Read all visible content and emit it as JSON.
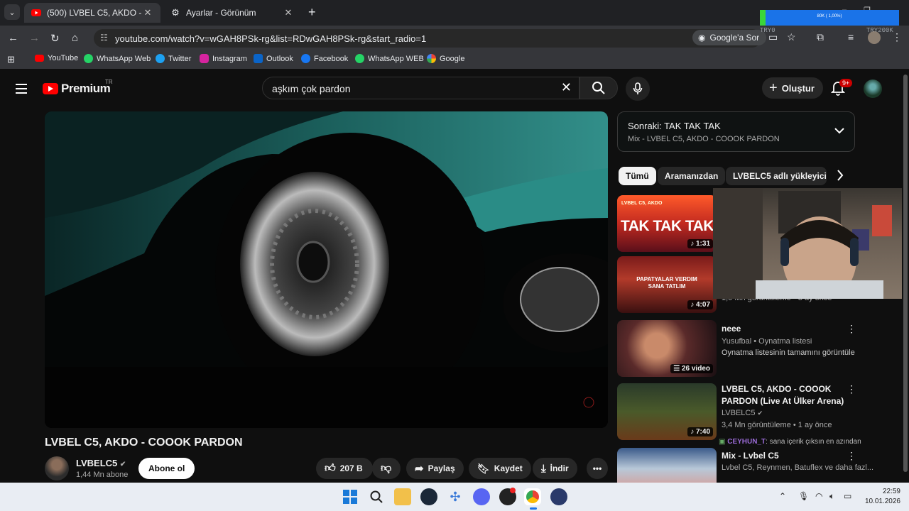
{
  "browser": {
    "tabs": [
      {
        "title": "(500) LVBEL C5, AKDO - COOO",
        "active": true
      },
      {
        "title": "Ayarlar - Görünüm",
        "active": false
      }
    ],
    "url": "youtube.com/watch?v=wGAH8PSk-rg&list=RDwGAH8PSk-rg&start_radio=1",
    "google_search_label": "Google'a Sor",
    "bookmarks": [
      "YouTube",
      "WhatsApp Web",
      "Twitter",
      "Instagram",
      "Outlook",
      "Facebook",
      "WhatsApp WEB",
      "Google"
    ]
  },
  "overlay_meter": {
    "text": "80K ( 1,00%)",
    "left_label": "TRY0",
    "right_label": "TRY200K",
    "fill_fraction": 0.04
  },
  "youtube": {
    "logo_text": "Premium",
    "region": "TR",
    "search_query": "aşkım çok pardon",
    "create_label": "Oluştur",
    "notification_count": "9+",
    "video": {
      "title": "LVBEL C5, AKDO - COOOK PARDON",
      "channel": "LVBELC5",
      "subscribers": "1,44 Mn abone",
      "subscribe_label": "Abone ol",
      "likes": "207 B",
      "share_label": "Paylaş",
      "save_label": "Kaydet",
      "download_label": "İndir"
    },
    "up_next": {
      "title": "Sonraki: TAK TAK TAK",
      "subtitle": "Mix - LVBEL C5, AKDO - COOOK PARDON"
    },
    "chips": [
      "Tümü",
      "Aramanızdan",
      "LVBELC5 adlı yükleyicide"
    ],
    "related": [
      {
        "thumb_text": "TAK TAK TAK",
        "thumb_sub": "LVBEL C5, AKDO",
        "duration": "1:31",
        "title": "",
        "meta": ""
      },
      {
        "thumb_text": "PAPATYALAR VERDIM SANA TATLIM",
        "duration": "4:07",
        "title": "",
        "meta": "1,0 Mn görüntüleme • 3 ay önce"
      },
      {
        "duration": "26 video",
        "title": "neee",
        "meta": "Yusufbal • Oynatma listesi",
        "meta2": "Oynatma listesinin tamamını görüntüle"
      },
      {
        "duration": "7:40",
        "title": "LVBEL C5, AKDO - COOOK PARDON (Live At Ülker Arena)",
        "meta": "LVBELC5",
        "meta2": "3,4 Mn görüntüleme • 1 ay önce"
      },
      {
        "title": "Mix - Lvbel C5",
        "meta": "Lvbel C5, Reynmen, Batuflex ve daha fazl..."
      }
    ],
    "chat": {
      "user": "CEYHUN_T",
      "message": ": sana içerik çıksın en azından"
    }
  },
  "taskbar": {
    "time": "22:59",
    "date": "10.01.2026"
  }
}
